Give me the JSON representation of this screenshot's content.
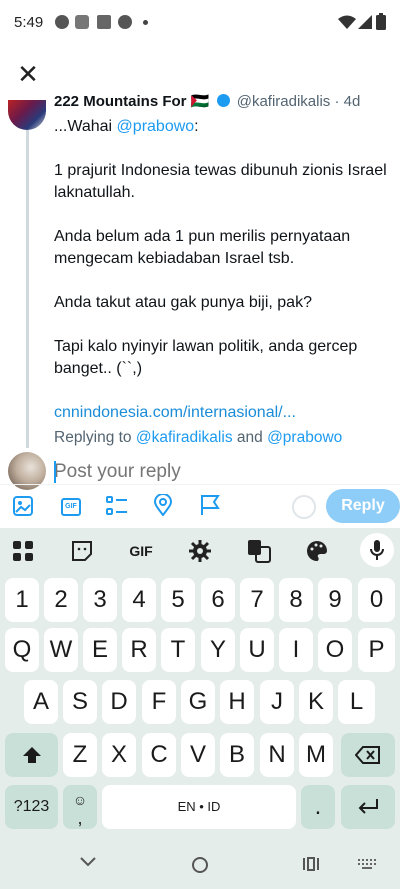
{
  "status": {
    "time": "5:49"
  },
  "tweet": {
    "author_name": "222 Mountains For 🇵🇸",
    "author_meta": "@kafiradikalis · 4d",
    "greeting_prefix": "...Wahai ",
    "greeting_mention": "@prabowo",
    "greeting_suffix": ":",
    "paragraphs": [
      "1 prajurit Indonesia tewas dibunuh zionis Israel laknatullah.",
      "Anda belum ada 1 pun merilis pernyataan mengecam kebiadaban Israel tsb.",
      "Anda takut atau gak punya biji, pak?",
      "Tapi kalo nyinyir lawan politik, anda gercep banget.. (``,)"
    ],
    "link": "cnnindonesia.com/internasional/..."
  },
  "replying": {
    "prefix": "Replying to ",
    "mention1": "@kafiradikalis",
    "and": " and ",
    "mention2": "@prabowo"
  },
  "composer": {
    "placeholder": "Post your reply",
    "reply_label": "Reply"
  },
  "keyboard": {
    "gif_label": "GIF",
    "row_numbers": [
      "1",
      "2",
      "3",
      "4",
      "5",
      "6",
      "7",
      "8",
      "9",
      "0"
    ],
    "row1": [
      "Q",
      "W",
      "E",
      "R",
      "T",
      "Y",
      "U",
      "I",
      "O",
      "P"
    ],
    "row2": [
      "A",
      "S",
      "D",
      "F",
      "G",
      "H",
      "J",
      "K",
      "L"
    ],
    "row3": [
      "Z",
      "X",
      "C",
      "V",
      "B",
      "N",
      "M"
    ],
    "symbols_label": "?123",
    "emoji_comma": ",",
    "space_label": "EN • ID",
    "period": "."
  }
}
